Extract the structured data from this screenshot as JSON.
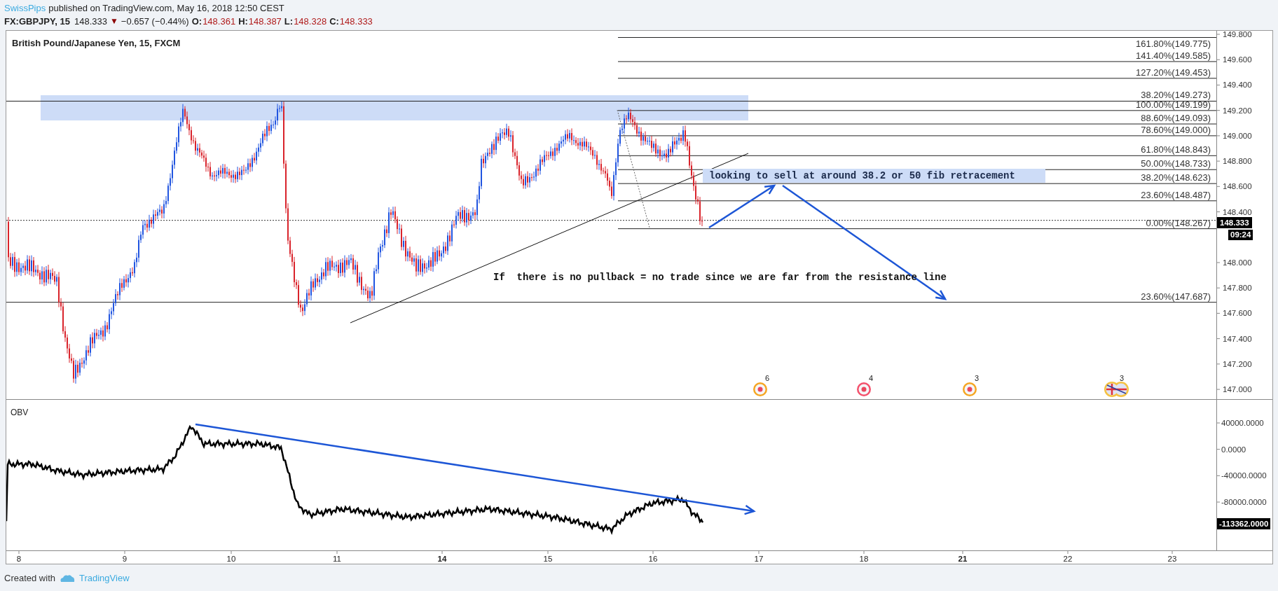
{
  "header": {
    "author": "SwissPips",
    "published": "published on TradingView.com, May 16, 2018 12:50 CEST",
    "symbol": "FX:GBPJPY, 15",
    "last": "148.333",
    "direction": "▼",
    "change": "−0.657 (−0.44%)",
    "ohlc": [
      {
        "label": "O:",
        "value": "148.361"
      },
      {
        "label": "H:",
        "value": "148.387"
      },
      {
        "label": "L:",
        "value": "148.328"
      },
      {
        "label": "C:",
        "value": "148.333"
      }
    ]
  },
  "main_pane": {
    "title": "British Pound/Japanese Yen, 15, FXCM",
    "fib_levels": [
      "161.80%(149.775)",
      "141.40%(149.585)",
      "127.20%(149.453)",
      "38.20%(149.273)",
      "100.00%(149.199)",
      "88.60%(149.093)",
      "78.60%(149.000)",
      "61.80%(148.843)",
      "50.00%(148.733)",
      "38.20%(148.623)",
      "23.60%(148.487)",
      "0.00%(148.267)",
      "23.60%(147.687)"
    ],
    "notes": [
      {
        "kind": "highlighted",
        "text": "looking to sell at around 38.2 or 50 fib retracement"
      },
      {
        "kind": "plain",
        "text": "If  there is no pullback = no trade since we are far from the resistance line"
      }
    ],
    "events": [
      {
        "kind": "dot",
        "color": "#f5a623",
        "count": "6"
      },
      {
        "kind": "dot",
        "color": "#f4516c",
        "count": "4"
      },
      {
        "kind": "dot",
        "color": "#f5a623",
        "count": "3"
      },
      {
        "kind": "flag",
        "color": "#f5c242",
        "count": "3"
      }
    ],
    "price_axis": [
      "149.800",
      "149.600",
      "149.400",
      "149.200",
      "149.000",
      "148.800",
      "148.600",
      "148.400",
      "148.000",
      "147.800",
      "147.600",
      "147.400",
      "147.200",
      "147.000"
    ],
    "last_price": "148.333",
    "countdown": "09:24"
  },
  "obv_pane": {
    "title": "OBV",
    "axis": [
      "40000.0000",
      "0.0000",
      "-40000.0000",
      "-80000.0000"
    ],
    "last_value": "-113362.0000"
  },
  "time_axis": [
    {
      "label": "8",
      "bold": false
    },
    {
      "label": "9",
      "bold": false
    },
    {
      "label": "10",
      "bold": false
    },
    {
      "label": "11",
      "bold": false
    },
    {
      "label": "14",
      "bold": true
    },
    {
      "label": "15",
      "bold": false
    },
    {
      "label": "16",
      "bold": false
    },
    {
      "label": "17",
      "bold": false
    },
    {
      "label": "18",
      "bold": false
    },
    {
      "label": "21",
      "bold": true
    },
    {
      "label": "22",
      "bold": false
    },
    {
      "label": "23",
      "bold": false
    }
  ],
  "footer": {
    "text": "Created with",
    "brand": "TradingView"
  }
}
